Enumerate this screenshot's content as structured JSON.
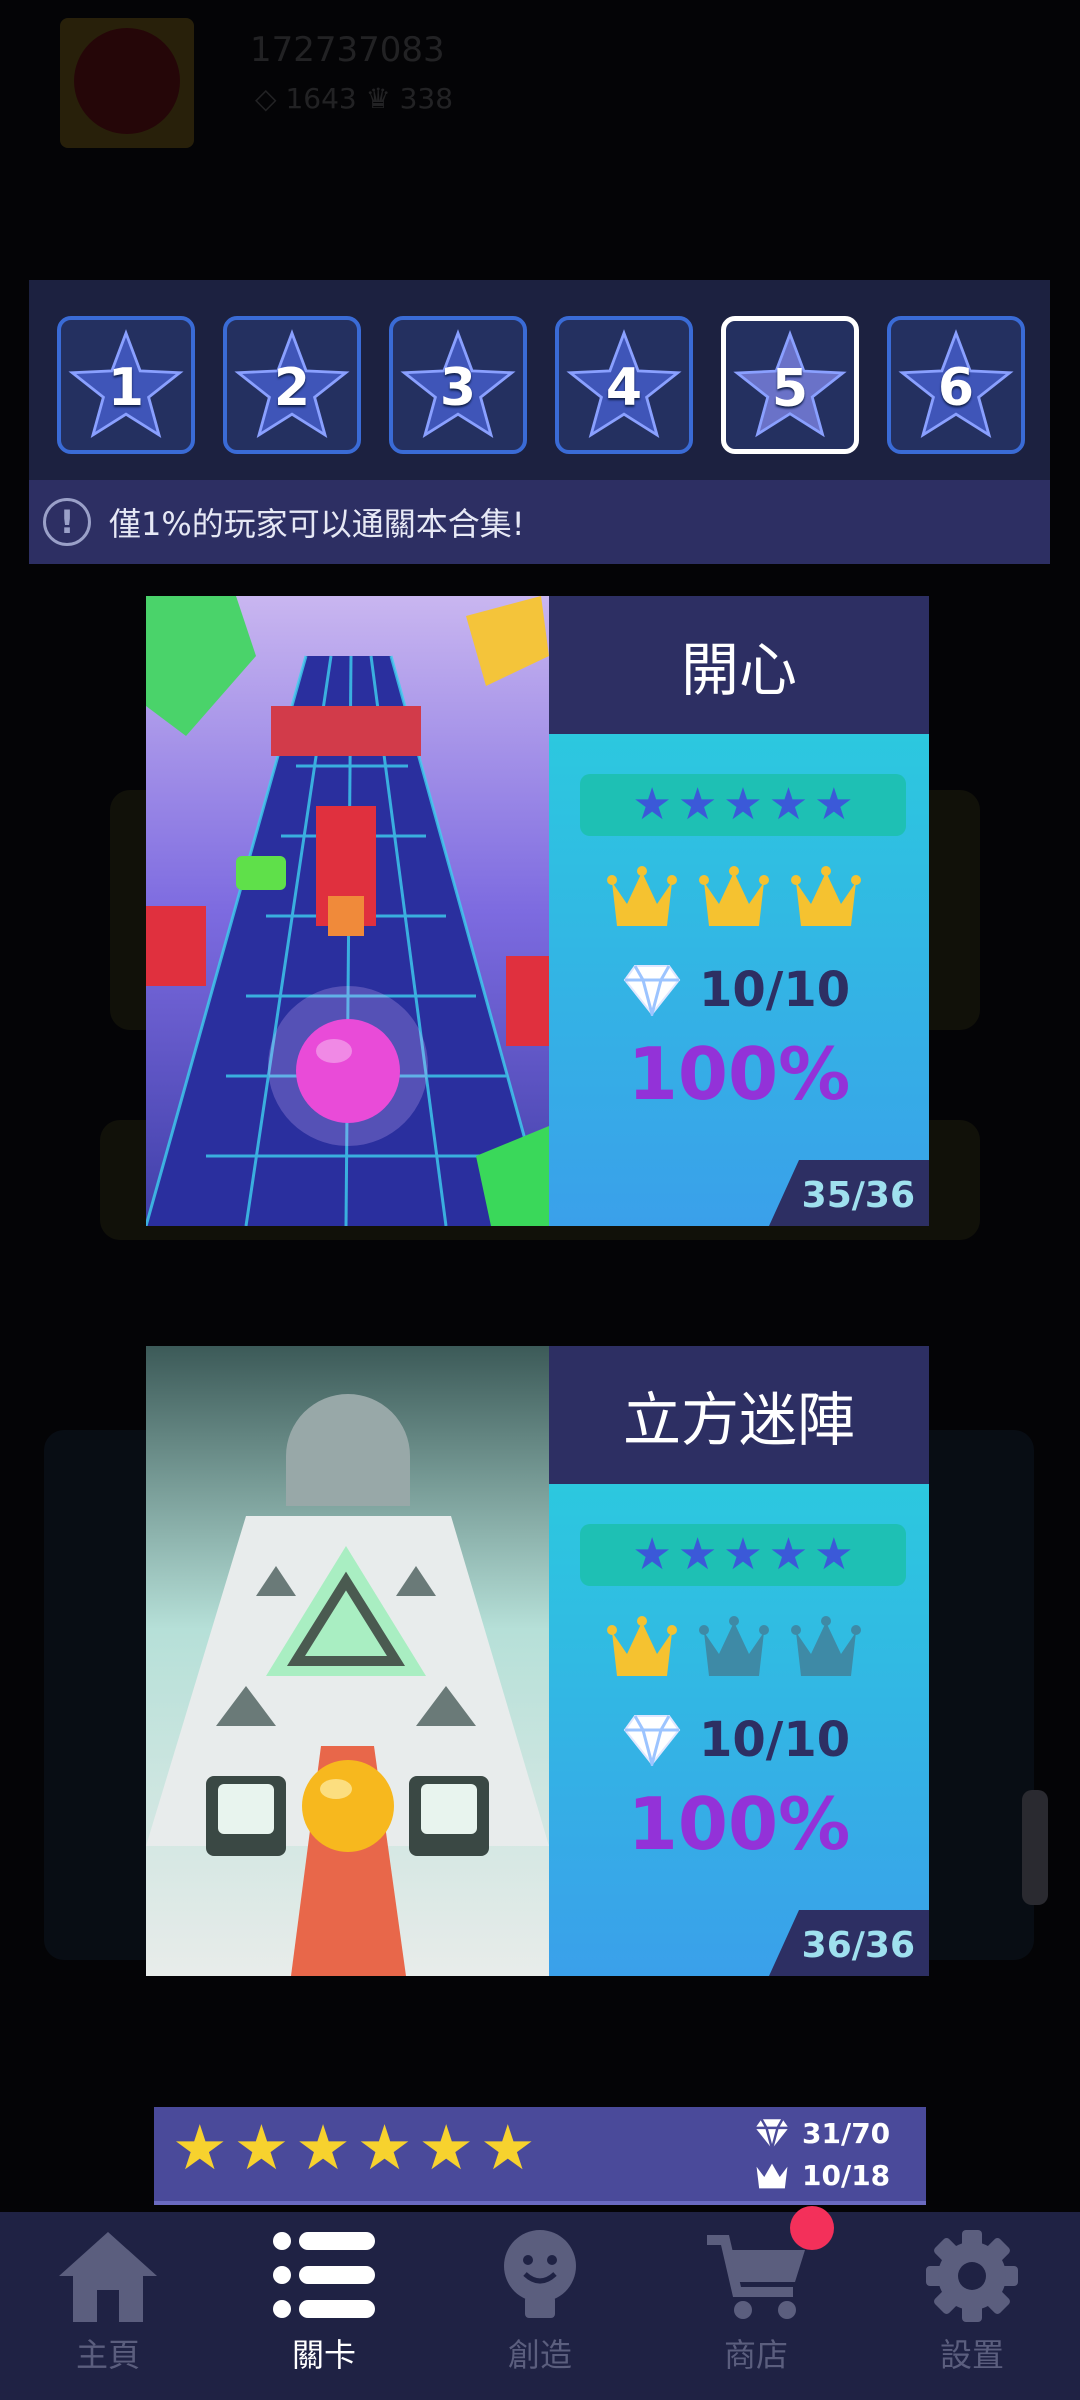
{
  "background": {
    "user_id": "172737083",
    "gems": "1643",
    "crowns": "338"
  },
  "level_tabs": [
    {
      "number": "1",
      "active": false
    },
    {
      "number": "2",
      "active": false
    },
    {
      "number": "3",
      "active": false
    },
    {
      "number": "4",
      "active": false
    },
    {
      "number": "5",
      "active": true
    },
    {
      "number": "6",
      "active": false
    }
  ],
  "notice": {
    "text": "僅1%的玩家可以通關本合集!"
  },
  "cards": [
    {
      "title": "開心",
      "stars": 5,
      "crowns_earned": 3,
      "crowns_total": 3,
      "gems": "10/10",
      "percent": "100%",
      "count": "35/36",
      "ball_color": "#e94bd8"
    },
    {
      "title": "立方迷陣",
      "stars": 5,
      "crowns_earned": 1,
      "crowns_total": 3,
      "gems": "10/10",
      "percent": "100%",
      "count": "36/36",
      "ball_color": "#f7b81e"
    }
  ],
  "summary": {
    "stars": 6,
    "gems": "31/70",
    "crowns": "10/18"
  },
  "nav": [
    {
      "label": "主頁",
      "icon": "home-icon",
      "active": false
    },
    {
      "label": "關卡",
      "icon": "list-icon",
      "active": true
    },
    {
      "label": "創造",
      "icon": "lightbulb-icon",
      "active": false
    },
    {
      "label": "商店",
      "icon": "cart-icon",
      "active": false,
      "badge": true
    },
    {
      "label": "設置",
      "icon": "gear-icon",
      "active": false
    }
  ],
  "colors": {
    "accent_blue": "#3a6bd6",
    "panel": "#2d2f63",
    "percent": "#9332d8",
    "star_gold": "#f7d22e",
    "badge_red": "#f3305a"
  }
}
